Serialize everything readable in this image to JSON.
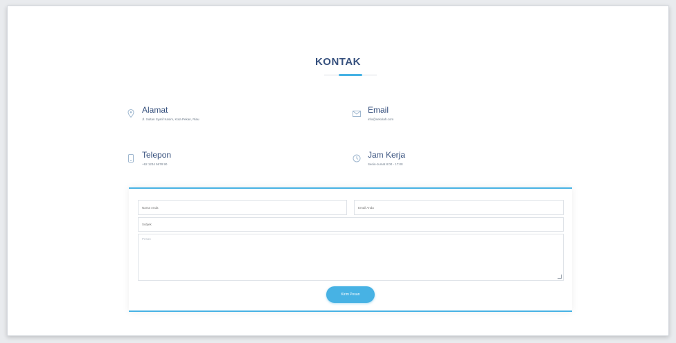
{
  "section": {
    "title": "KONTAK"
  },
  "info": {
    "address": {
      "label": "Alamat",
      "value": "Jl. Sultan Syarif Kasim, Kota Pekan, Riau",
      "icon": "map-pin-icon"
    },
    "email": {
      "label": "Email",
      "value": "info@sekolah.com",
      "icon": "envelope-icon"
    },
    "phone": {
      "label": "Telepon",
      "value": "+62 1234 5678 90",
      "icon": "phone-icon"
    },
    "hours": {
      "label": "Jam Kerja",
      "value": "Senin-Jumat 8:00 - 17:00",
      "icon": "clock-icon"
    }
  },
  "form": {
    "name_placeholder": "Nama Anda",
    "email_placeholder": "Email Anda",
    "subject_placeholder": "Subjek",
    "message_placeholder": "Pesan",
    "send_label": "Kirim Pesan"
  },
  "colors": {
    "accent": "#47b2e4",
    "heading": "#37517e",
    "icon": "#9fb7cf"
  }
}
